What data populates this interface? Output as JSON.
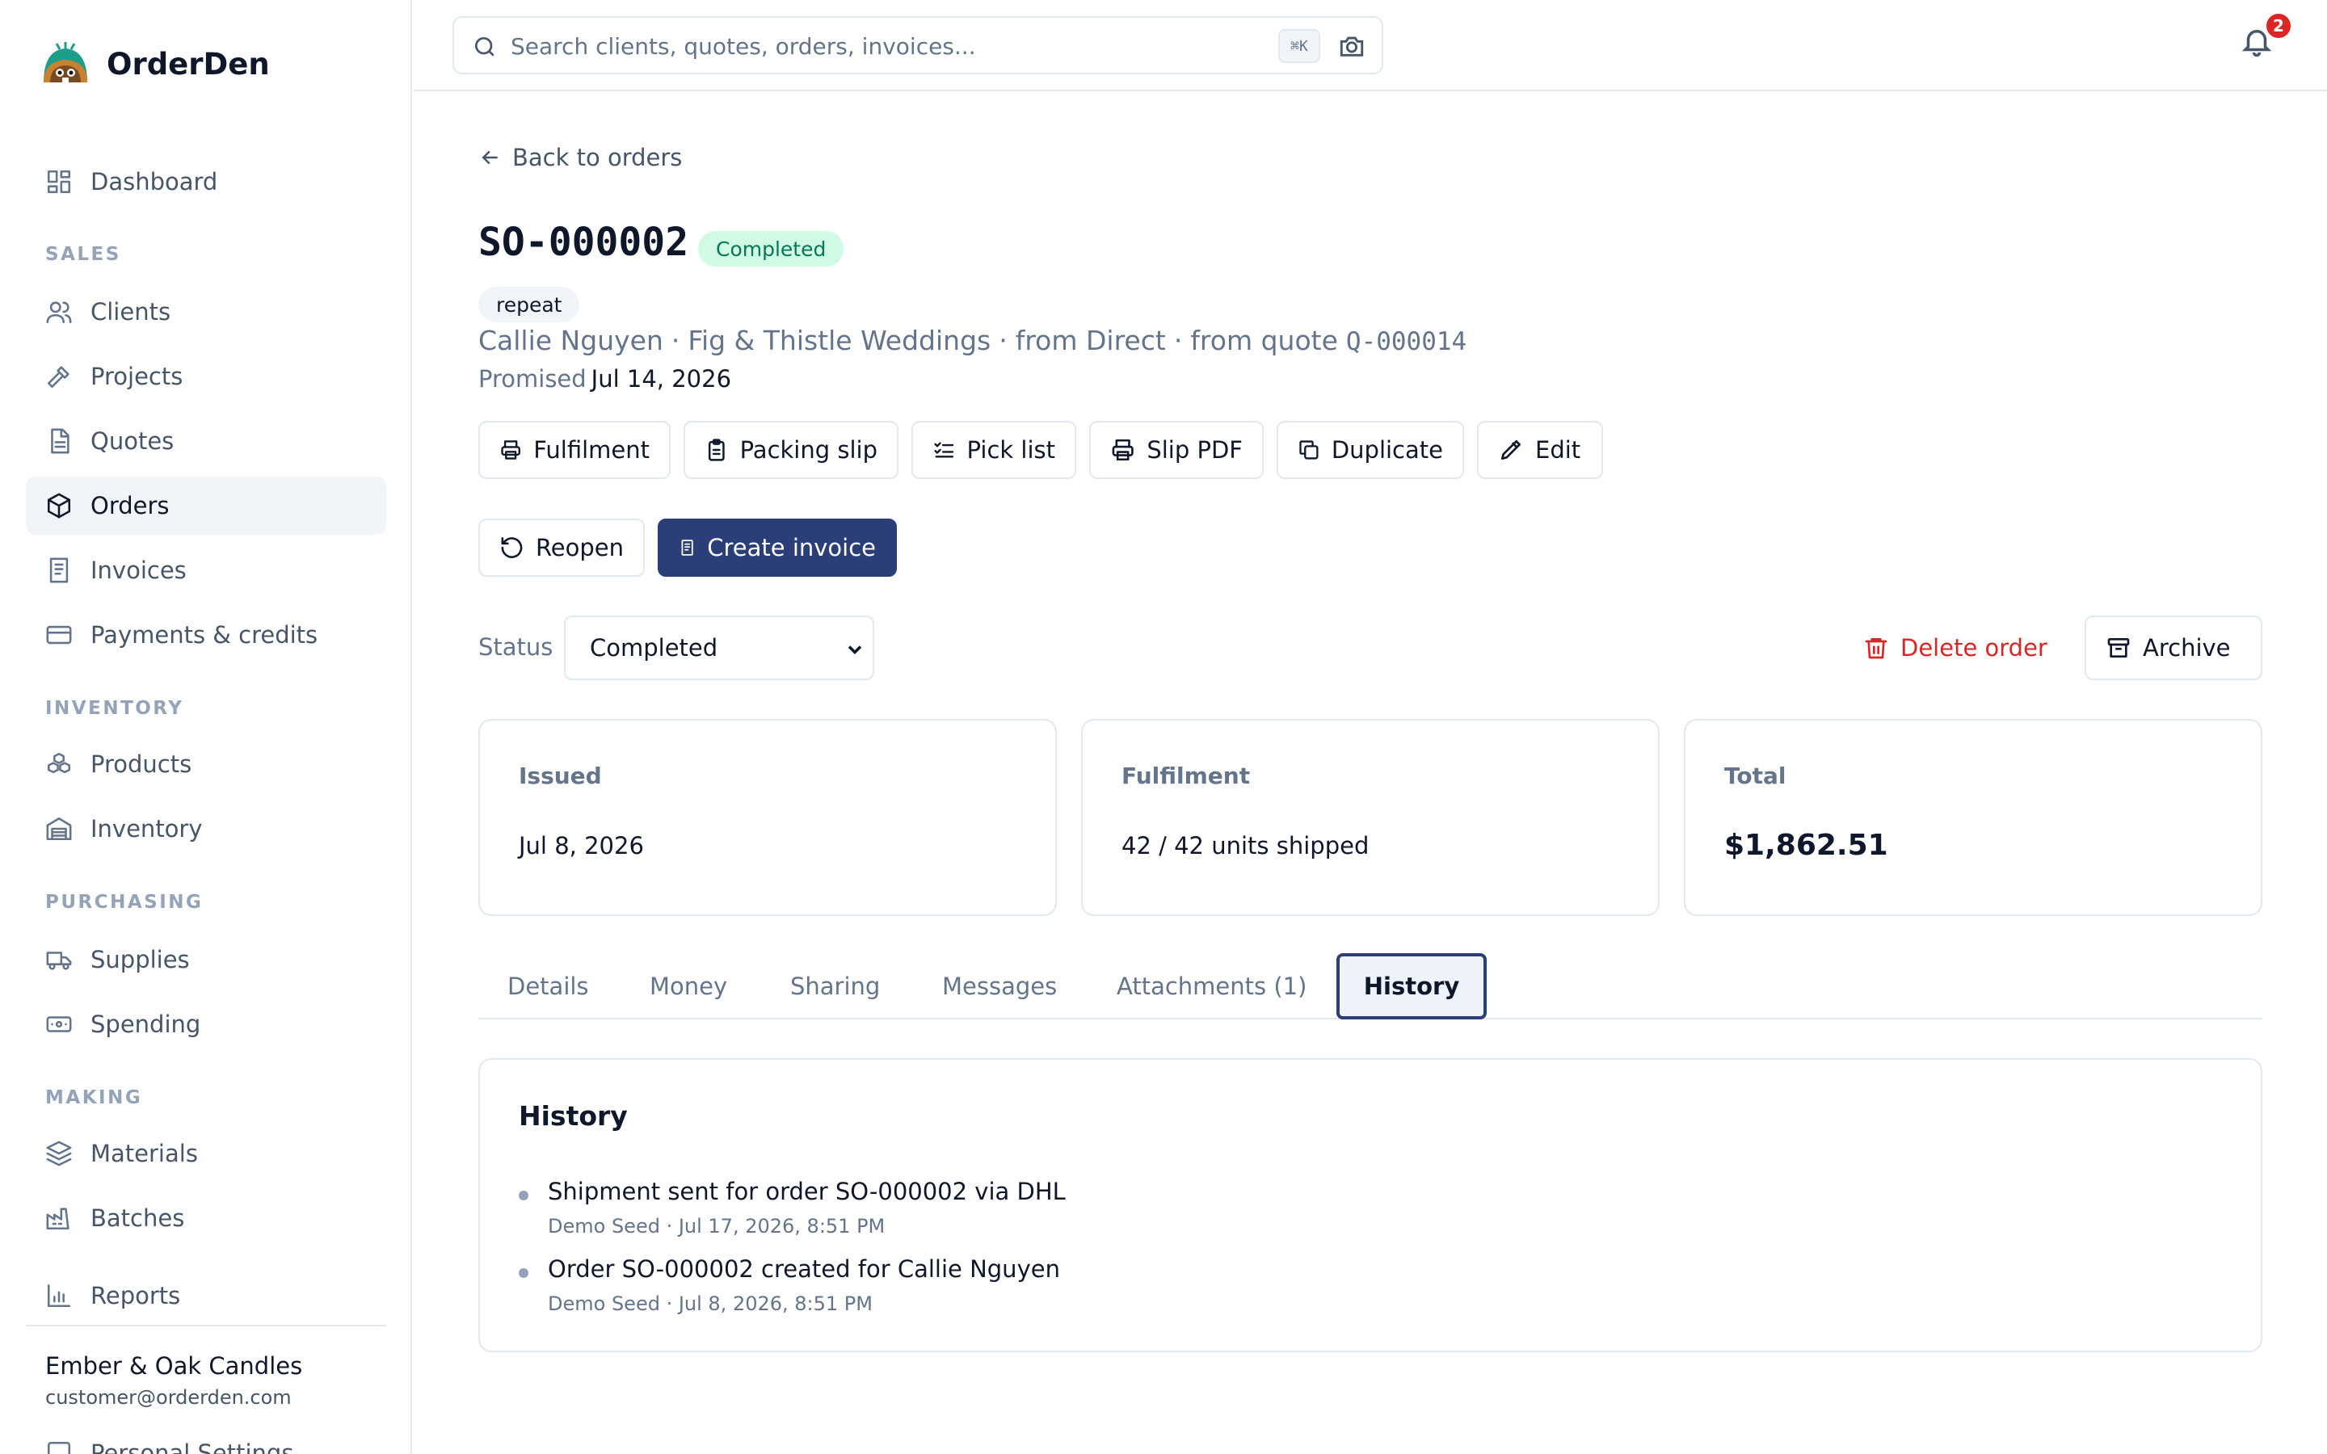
{
  "app": {
    "name": "OrderDen"
  },
  "sidebar": {
    "dashboard": "Dashboard",
    "sections": {
      "sales": "SALES",
      "inventory": "INVENTORY",
      "purchasing": "PURCHASING",
      "making": "MAKING"
    },
    "items": {
      "clients": "Clients",
      "projects": "Projects",
      "quotes": "Quotes",
      "orders": "Orders",
      "invoices": "Invoices",
      "payments": "Payments & credits",
      "products": "Products",
      "inventory": "Inventory",
      "supplies": "Supplies",
      "spending": "Spending",
      "materials": "Materials",
      "batches": "Batches",
      "reports": "Reports"
    },
    "active_item": "orders",
    "account": {
      "name": "Ember & Oak Candles",
      "email": "customer@orderden.com"
    },
    "cutoff_item": "Personal Settings"
  },
  "topbar": {
    "search_placeholder": "Search clients, quotes, orders, invoices...",
    "search_value": "",
    "shortcut": "⌘K",
    "notifications_count": "2"
  },
  "order": {
    "back_label": "Back to orders",
    "number": "SO-000002",
    "status_badge": "Completed",
    "tag": "repeat",
    "client": "Callie Nguyen",
    "company": "Fig & Thistle Weddings",
    "source": "from Direct",
    "quote_prefix": "from quote",
    "quote_number": "Q-000014",
    "separator": "·",
    "promised_label": "Promised",
    "promised_date": "Jul 14, 2026"
  },
  "actions": {
    "fulfilment": "Fulfilment",
    "packing_slip": "Packing slip",
    "pick_list": "Pick list",
    "slip_pdf": "Slip PDF",
    "duplicate": "Duplicate",
    "edit": "Edit",
    "reopen": "Reopen",
    "create_invoice": "Create invoice",
    "delete_order": "Delete order",
    "archive": "Archive"
  },
  "status_field": {
    "label": "Status",
    "value": "Completed"
  },
  "cards": {
    "issued": {
      "label": "Issued",
      "value": "Jul 8, 2026"
    },
    "fulfilment": {
      "label": "Fulfilment",
      "value": "42 / 42 units shipped"
    },
    "total": {
      "label": "Total",
      "value": "$1,862.51"
    }
  },
  "tabs": [
    "Details",
    "Money",
    "Sharing",
    "Messages",
    "Attachments (1)",
    "History"
  ],
  "active_tab": "History",
  "history": {
    "title": "History",
    "entries": [
      {
        "text": "Shipment sent for order SO-000002 via DHL",
        "meta": "Demo Seed · Jul 17, 2026, 8:51 PM"
      },
      {
        "text": "Order SO-000002 created for Callie Nguyen",
        "meta": "Demo Seed · Jul 8, 2026, 8:51 PM"
      }
    ]
  },
  "colors": {
    "accent": "#2c3e77",
    "success_bg": "#d1fae5",
    "success_text": "#047857",
    "danger": "#dc2626",
    "muted": "#64748b"
  }
}
